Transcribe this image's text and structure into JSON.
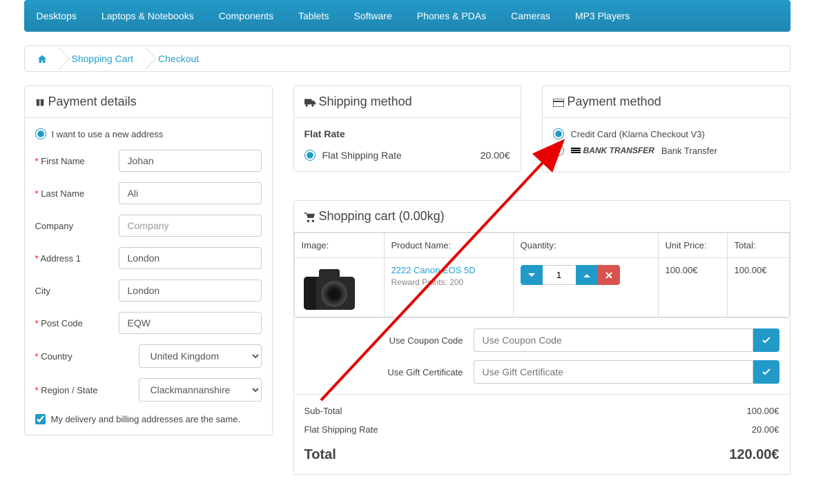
{
  "nav": [
    "Desktops",
    "Laptops & Notebooks",
    "Components",
    "Tablets",
    "Software",
    "Phones & PDAs",
    "Cameras",
    "MP3 Players"
  ],
  "breadcrumb": {
    "home": "home",
    "cart": "Shopping Cart",
    "checkout": "Checkout"
  },
  "payment_details": {
    "title": "Payment details",
    "new_address_label": "I want to use a new address",
    "fields": {
      "first_name": {
        "label": "First Name",
        "value": "Johan",
        "required": true
      },
      "last_name": {
        "label": "Last Name",
        "value": "Ali",
        "required": true
      },
      "company": {
        "label": "Company",
        "value": "",
        "placeholder": "Company",
        "required": false
      },
      "address1": {
        "label": "Address 1",
        "value": "London",
        "required": true
      },
      "city": {
        "label": "City",
        "value": "London",
        "required": false
      },
      "postcode": {
        "label": "Post Code",
        "value": "EQW",
        "required": true
      },
      "country": {
        "label": "Country",
        "value": "United Kingdom",
        "required": true
      },
      "region": {
        "label": "Region / State",
        "value": "Clackmannanshire",
        "required": true
      }
    },
    "same_address_label": "My delivery and billing addresses are the same."
  },
  "shipping_method": {
    "title": "Shipping method",
    "group": "Flat Rate",
    "option": "Flat Shipping Rate",
    "price": "20.00€"
  },
  "payment_method": {
    "title": "Payment method",
    "credit": "Credit Card (Klarna Checkout V3)",
    "bank_logo": "BANK TRANSFER",
    "bank": "Bank Transfer"
  },
  "cart": {
    "title": "Shopping cart (0.00kg)",
    "headers": {
      "image": "Image:",
      "product": "Product Name:",
      "qty": "Quantity:",
      "unit": "Unit Price:",
      "total": "Total:"
    },
    "item": {
      "name": "2222 Canon EOS 5D",
      "reward": "Reward Points: 200",
      "qty": "1",
      "unit": "100.00€",
      "total": "100.00€"
    },
    "coupon_label": "Use Coupon Code",
    "coupon_placeholder": "Use Coupon Code",
    "gift_label": "Use Gift Certificate",
    "gift_placeholder": "Use Gift Certificate",
    "totals": {
      "subtotal_label": "Sub-Total",
      "subtotal": "100.00€",
      "shipping_label": "Flat Shipping Rate",
      "shipping": "20.00€",
      "total_label": "Total",
      "total": "120.00€"
    }
  }
}
